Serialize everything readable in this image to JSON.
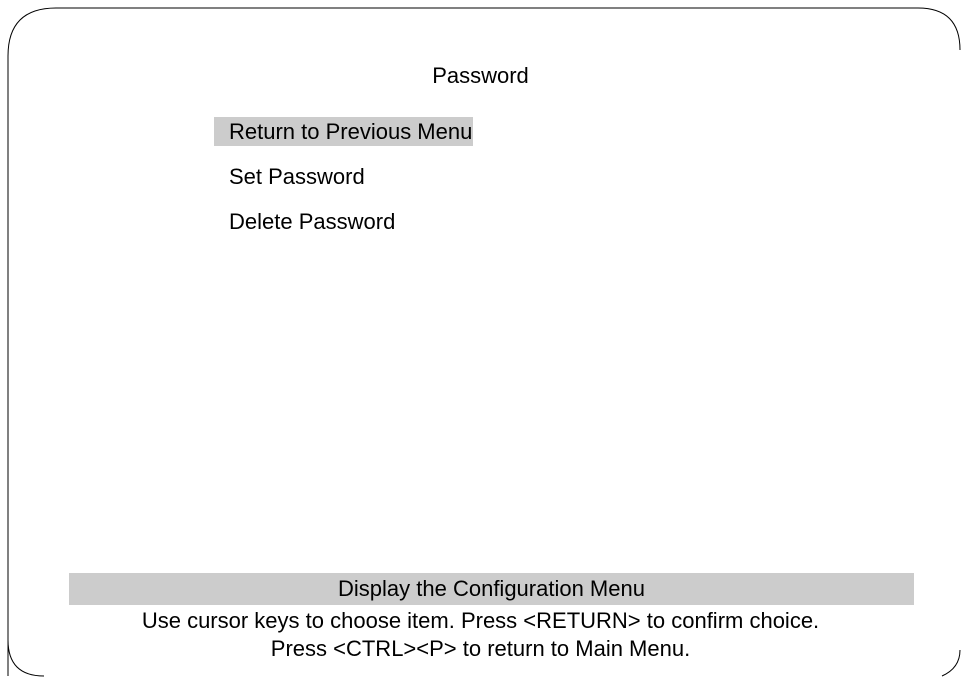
{
  "screen": {
    "title": "Password"
  },
  "menu": {
    "items": [
      {
        "label": "Return to Previous Menu",
        "selected": true
      },
      {
        "label": "Set Password",
        "selected": false
      },
      {
        "label": "Delete Password",
        "selected": false
      }
    ]
  },
  "status": {
    "description": "Display the Configuration Menu"
  },
  "help": {
    "line1": "Use cursor keys to choose item. Press <RETURN> to confirm choice.",
    "line2": "Press <CTRL><P> to return to Main Menu."
  },
  "colors": {
    "highlight": "#cccccc",
    "background": "#ffffff",
    "text": "#000000"
  }
}
